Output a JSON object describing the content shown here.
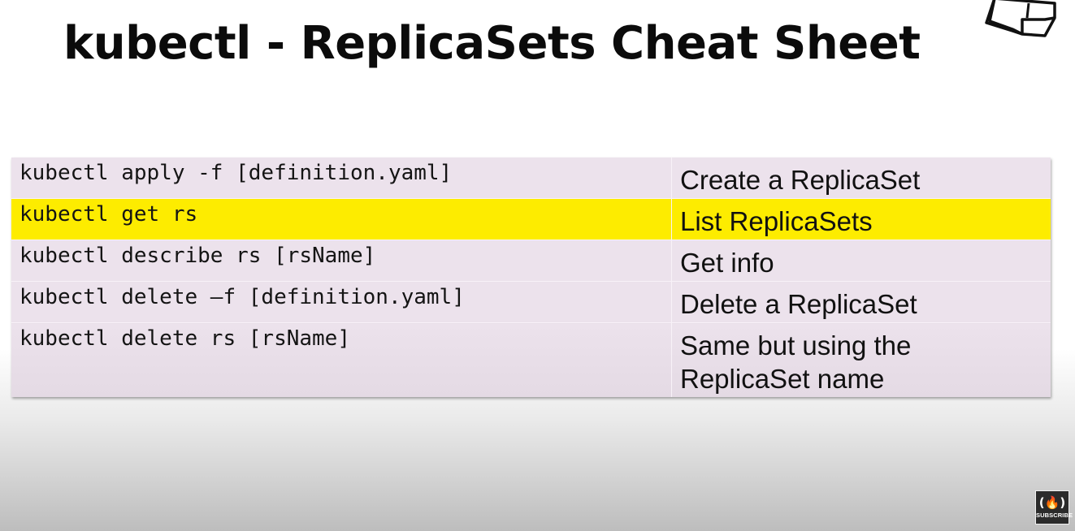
{
  "slide": {
    "title": "kubectl - ReplicaSets Cheat Sheet"
  },
  "colors": {
    "highlight": "#fdec00",
    "row_background": "#ece2ec",
    "title_text": "#0b0b0b"
  },
  "table": {
    "rows": [
      {
        "command": "kubectl apply -f [definition.yaml]",
        "description": "Create a ReplicaSet",
        "highlighted": false
      },
      {
        "command": "kubectl get rs",
        "description": "List ReplicaSets",
        "highlighted": true
      },
      {
        "command": "kubectl describe rs [rsName]",
        "description": "Get info",
        "highlighted": false
      },
      {
        "command": "kubectl delete –f [definition.yaml]",
        "description": "Delete a ReplicaSet",
        "highlighted": false
      },
      {
        "command": "kubectl delete rs [rsName]",
        "description": "Same but using the ReplicaSet name",
        "highlighted": false
      }
    ]
  },
  "icons": {
    "corner_logo": "sticky-note-logo-icon",
    "subscribe": "freecodecamp-logo-icon"
  },
  "subscribe": {
    "glyph": "(🔥)",
    "label": "SUBSCRIBE"
  }
}
